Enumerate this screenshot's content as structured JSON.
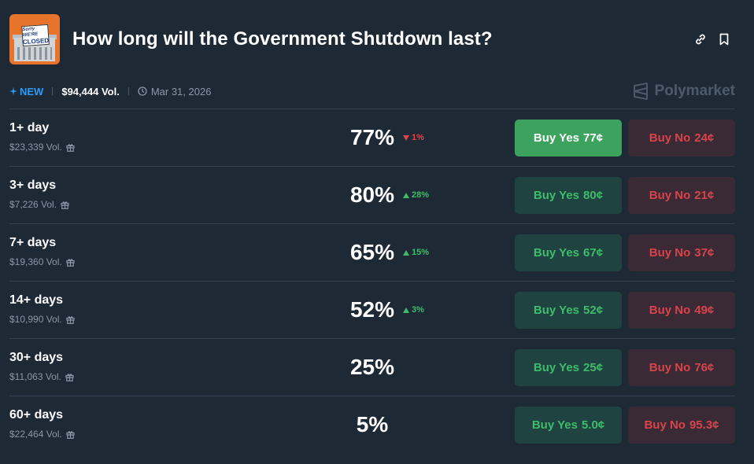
{
  "header": {
    "title": "How long will the Government Shutdown last?",
    "thumbnail_text_1": "Sorry WE'RE",
    "thumbnail_text_2": "CLOSED"
  },
  "meta": {
    "new_label": "NEW",
    "volume": "$94,444 Vol.",
    "date": "Mar 31, 2026",
    "brand": "Polymarket"
  },
  "colors": {
    "background": "#1e2936",
    "accent_blue": "#2e9af5",
    "green": "#3fbc6b",
    "red": "#d9434b"
  },
  "markets": [
    {
      "label": "1+ day",
      "volume": "$23,339 Vol.",
      "percent": "77%",
      "change": "1%",
      "direction": "down",
      "yes_label": "Buy Yes",
      "yes_price": "77¢",
      "no_label": "Buy No",
      "no_price": "24¢"
    },
    {
      "label": "3+ days",
      "volume": "$7,226 Vol.",
      "percent": "80%",
      "change": "28%",
      "direction": "up",
      "yes_label": "Buy Yes",
      "yes_price": "80¢",
      "no_label": "Buy No",
      "no_price": "21¢"
    },
    {
      "label": "7+ days",
      "volume": "$19,360 Vol.",
      "percent": "65%",
      "change": "15%",
      "direction": "up",
      "yes_label": "Buy Yes",
      "yes_price": "67¢",
      "no_label": "Buy No",
      "no_price": "37¢"
    },
    {
      "label": "14+ days",
      "volume": "$10,990 Vol.",
      "percent": "52%",
      "change": "3%",
      "direction": "up",
      "yes_label": "Buy Yes",
      "yes_price": "52¢",
      "no_label": "Buy No",
      "no_price": "49¢"
    },
    {
      "label": "30+ days",
      "volume": "$11,063 Vol.",
      "percent": "25%",
      "change": "",
      "direction": "",
      "yes_label": "Buy Yes",
      "yes_price": "25¢",
      "no_label": "Buy No",
      "no_price": "76¢"
    },
    {
      "label": "60+ days",
      "volume": "$22,464 Vol.",
      "percent": "5%",
      "change": "",
      "direction": "",
      "yes_label": "Buy Yes",
      "yes_price": "5.0¢",
      "no_label": "Buy No",
      "no_price": "95.3¢"
    }
  ]
}
